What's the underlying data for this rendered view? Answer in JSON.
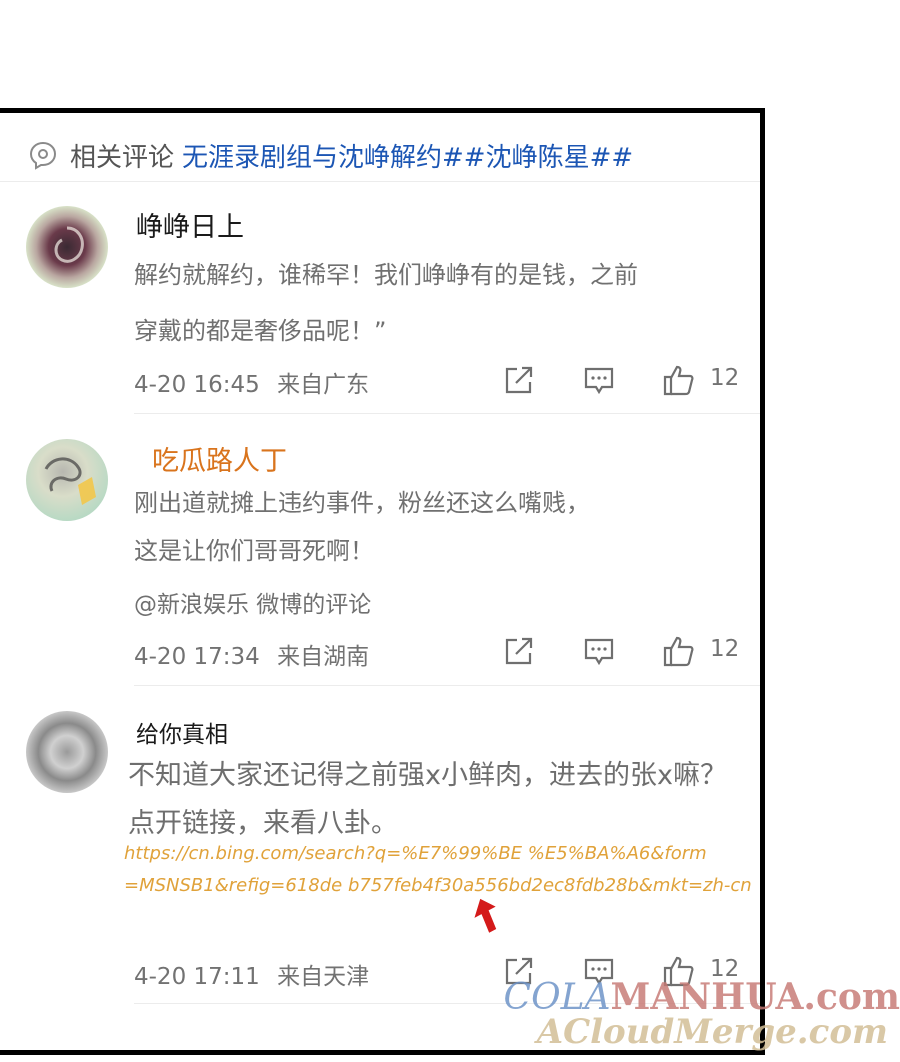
{
  "header": {
    "label": "相关评论",
    "topic": "无涯录剧组与沈峥解约##沈峥陈星##"
  },
  "comments": [
    {
      "username": "峥峥日上",
      "lines": [
        "解约就解约，谁稀罕！我们峥峥有的是钱，之前",
        "穿戴的都是奢侈品呢！”"
      ],
      "time": "4-20 16:45",
      "location": "来自广东",
      "likes": "12"
    },
    {
      "username": "吃瓜路人丁",
      "lines": [
        "刚出道就摊上违约事件，粉丝还这么嘴贱，",
        "这是让你们哥哥死啊！"
      ],
      "mention": "@新浪娱乐 微博的评论",
      "time": "4-20 17:34",
      "location": "来自湖南",
      "likes": "12"
    },
    {
      "username": "给你真相",
      "lines": [
        "不知道大家还记得之前强x小鲜肉，进去的张x嘛？",
        "点开链接，来看八卦。"
      ],
      "link_lines": [
        "https://cn.bing.com/search?q=%E7%99%BE %E5%BA%A6&form",
        "=MSNSB1&refig=618de b757feb4f30a556bd2ec8fdb28b&mkt=zh-cn"
      ],
      "time": "4-20 17:11",
      "location": "来自天津",
      "likes": "12"
    }
  ],
  "watermark": {
    "line1_prefix": "COLA",
    "line1_rest": "MANHUA.com",
    "line2": "ACloudMerge.com"
  },
  "icons": {
    "header": "comment-bubble-icon",
    "share": "share-icon",
    "reply": "reply-icon",
    "like": "thumbs-up-icon"
  },
  "colors": {
    "topic": "#1c56b4",
    "orange_username": "#d9741d",
    "link": "#e0a23a",
    "arrow": "#d41a1a"
  }
}
